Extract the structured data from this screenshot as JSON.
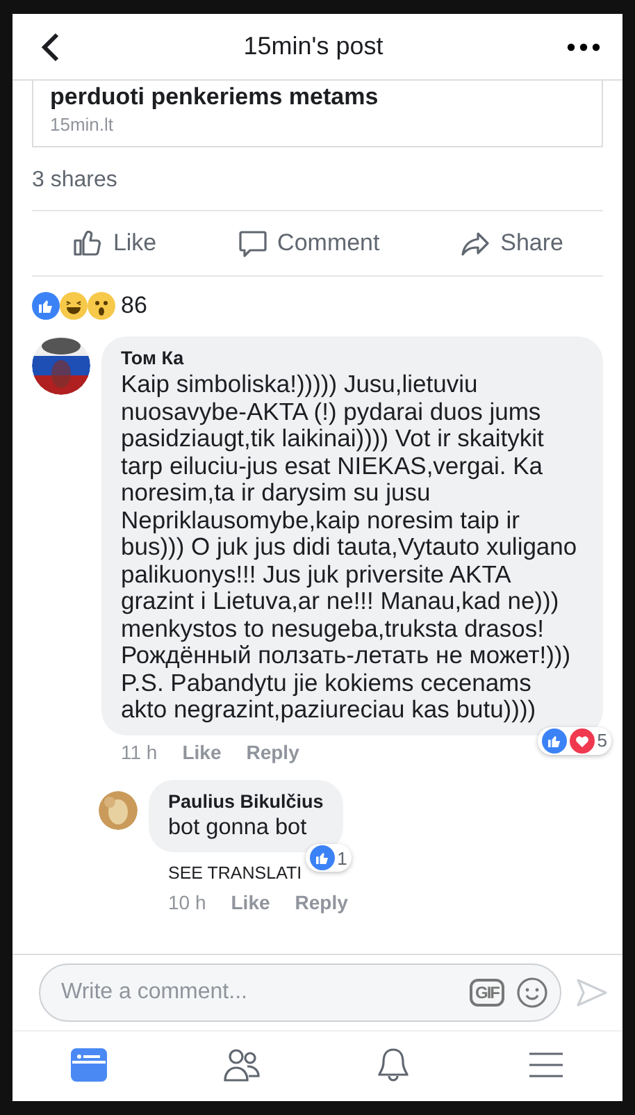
{
  "header": {
    "title": "15min's post"
  },
  "link_card": {
    "headline": "perduoti penkeriems metams",
    "source": "15min.lt"
  },
  "shares": "3 shares",
  "actions": [
    {
      "kind": "like",
      "label": "Like"
    },
    {
      "kind": "comment",
      "label": "Comment"
    },
    {
      "kind": "share",
      "label": "Share"
    }
  ],
  "reactions": {
    "count": "86"
  },
  "comments": [
    {
      "author": "Том Ка",
      "text": "Kaip simboliska!))))) Jusu,lietuviu nuosavybe-AKTA (!) pydarai duos jums pasidziaugt,tik laikinai)))) Vot ir skaitykit tarp eiluciu-jus esat NIEKAS,vergai. Ka noresim,ta ir darysim su jusu Nepriklausomybe,kaip noresim taip ir bus))) O juk jus didi tauta,Vytauto xuligano palikuonys!!! Jus juk priversite AKTA grazint i Lietuva,ar ne!!! Manau,kad ne))) menkystos to nesugeba,truksta drasos! Рождённый ползать-летать не может!))) P.S. Pabandytu jie kokiems cecenams akto negrazint,paziureciau kas butu))))",
      "time": "11 h",
      "like": "Like",
      "reply": "Reply",
      "reaction_count": "5",
      "reply_level": false
    },
    {
      "author": "Paulius Bikulčius",
      "text": "bot gonna bot",
      "translate": "SEE TRANSLATI",
      "time": "10 h",
      "like": "Like",
      "reply": "Reply",
      "reaction_count": "1",
      "reply_level": true
    }
  ],
  "composer": {
    "placeholder": "Write a comment...",
    "gif": "GIF"
  },
  "nav": [
    {
      "kind": "feed",
      "selected": true
    },
    {
      "kind": "friends",
      "selected": false
    },
    {
      "kind": "notifications",
      "selected": false
    },
    {
      "kind": "menu",
      "selected": false
    }
  ]
}
